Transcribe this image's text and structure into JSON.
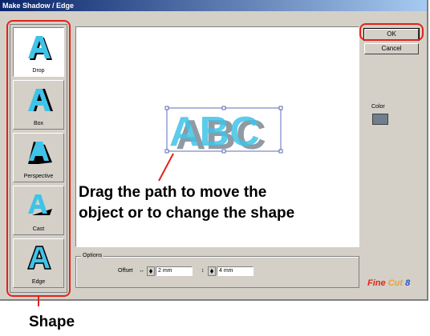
{
  "window": {
    "title": "Make Shadow / Edge"
  },
  "shapes": [
    {
      "label": "Drop",
      "selected": true
    },
    {
      "label": "Box",
      "selected": false
    },
    {
      "label": "Perspective",
      "selected": false
    },
    {
      "label": "Cast",
      "selected": false
    },
    {
      "label": "Edge",
      "selected": false
    }
  ],
  "preview": {
    "text": "ABC"
  },
  "buttons": {
    "ok": "OK",
    "cancel": "Cancel"
  },
  "color": {
    "label": "Color",
    "swatch": "#6f7f8f"
  },
  "options": {
    "legend": "Options",
    "offset_label": "Offset",
    "offset_x_value": "2 mm",
    "offset_y_value": "4 mm"
  },
  "logo": {
    "text": "Fine Cut 8"
  },
  "annotations": {
    "callout_line1": "Drag the path to move the",
    "callout_line2": "object or to change the shape",
    "shape_caption": "Shape"
  },
  "colors": {
    "highlight_red": "#e2231a",
    "glyph_cyan": "#3fc3e8"
  }
}
